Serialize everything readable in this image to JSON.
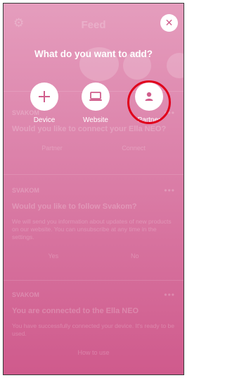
{
  "header": {
    "title": "Feed",
    "settings_icon": "gear-icon"
  },
  "feed": {
    "cards": [
      {
        "brand": "SVAKOM",
        "time": "",
        "heading": "Would you like to connect your Ella NEO?",
        "body": "",
        "actions": [
          "Partner",
          "Connect"
        ]
      },
      {
        "brand": "SVAKOM",
        "time": "",
        "heading": "Would you like to follow Svakom?",
        "body": "We will send you information about updates of new products on our website. You can unsubscribe at any time in the settings.",
        "actions": [
          "Yes",
          "No"
        ]
      },
      {
        "brand": "SVAKOM",
        "time": "",
        "heading": "You are connected to the Ella NEO",
        "body": "You have successfully connected your device. It's ready to be used.",
        "actions": [
          "How to use"
        ]
      }
    ]
  },
  "overlay": {
    "prompt": "What do you want to add?",
    "close_icon": "close-icon",
    "options": [
      {
        "label": "Device",
        "icon": "plus-icon"
      },
      {
        "label": "Website",
        "icon": "laptop-icon"
      },
      {
        "label": "Partner",
        "icon": "person-icon"
      }
    ],
    "highlight_color": "#e0001b"
  },
  "colors": {
    "background_top": "#e59dbd",
    "background_bottom": "#cf5a8c",
    "accent": "#d05e8c"
  }
}
